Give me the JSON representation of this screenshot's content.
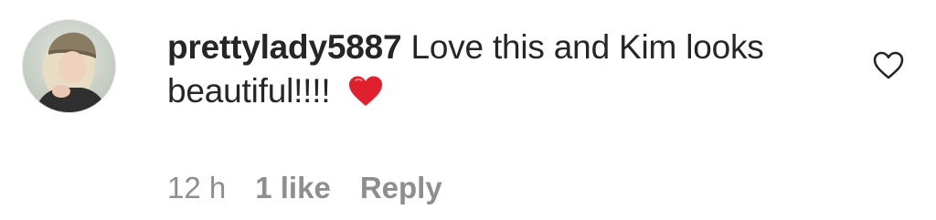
{
  "comment": {
    "username": "prettylady5887",
    "text": " Love this and Kim looks beautiful!!!! ",
    "emoji": "heart-red",
    "time": "12 h",
    "likes": "1 like",
    "reply_label": "Reply",
    "icons": {
      "like": "heart-outline-icon",
      "avatar": "user-avatar"
    },
    "colors": {
      "text": "#262626",
      "meta": "#8e8e8e",
      "emoji": "#e0202c"
    }
  }
}
